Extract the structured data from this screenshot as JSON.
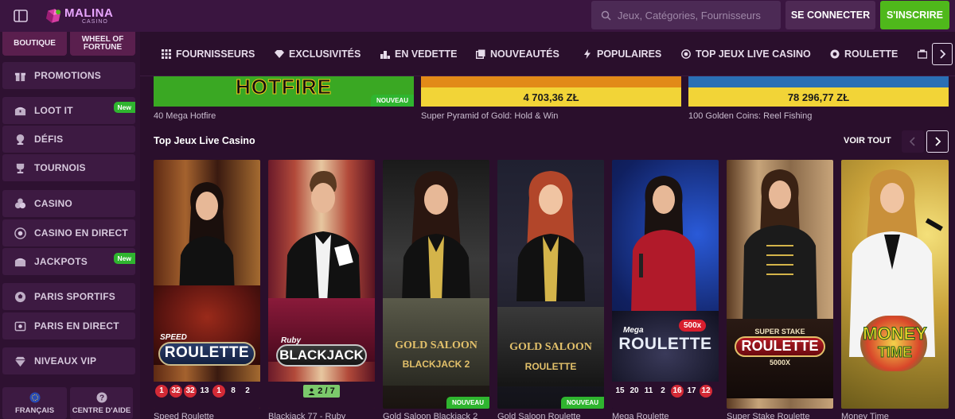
{
  "header": {
    "brand_name": "MALINA",
    "brand_sub": "CASINO",
    "search_placeholder": "Jeux, Catégories, Fournisseurs",
    "login_label": "SE CONNECTER",
    "signup_label": "S'INSCRIRE"
  },
  "sidebar": {
    "top_items": [
      {
        "label": "BOUTIQUE"
      },
      {
        "label": "WHEEL OF FORTUNE"
      }
    ],
    "items": [
      {
        "label": "PROMOTIONS",
        "icon": "gift-icon"
      },
      {
        "label": "LOOT IT",
        "icon": "chest-icon",
        "badge": "New"
      },
      {
        "label": "DÉFIS",
        "icon": "trophy-icon"
      },
      {
        "label": "TOURNOIS",
        "icon": "cup-icon"
      },
      {
        "label": "CASINO",
        "icon": "dice-icon"
      },
      {
        "label": "CASINO EN DIRECT",
        "icon": "roulette-icon"
      },
      {
        "label": "JACKPOTS",
        "icon": "chest-icon",
        "badge": "New"
      },
      {
        "label": "PARIS SPORTIFS",
        "icon": "football-icon"
      },
      {
        "label": "PARIS EN DIRECT",
        "icon": "live-icon"
      },
      {
        "label": "NIVEAUX VIP",
        "icon": "diamond-icon"
      }
    ],
    "bottom": [
      {
        "label": "FRANÇAIS",
        "icon": "flag-eu-icon"
      },
      {
        "label": "CENTRE D'AIDE",
        "icon": "help-icon"
      }
    ]
  },
  "categories": [
    {
      "label": "FOURNISSEURS",
      "icon": "grid-icon"
    },
    {
      "label": "EXCLUSIVITÉS",
      "icon": "gem-icon"
    },
    {
      "label": "EN VEDETTE",
      "icon": "podium-icon"
    },
    {
      "label": "NOUVEAUTÉS",
      "icon": "new-icon"
    },
    {
      "label": "POPULAIRES",
      "icon": "bolt-icon"
    },
    {
      "label": "TOP JEUX LIVE CASINO",
      "icon": "live-icon"
    },
    {
      "label": "ROULETTE",
      "icon": "roulette-icon"
    }
  ],
  "top_cards": [
    {
      "title": "40 Mega Hotfire",
      "banner": "HOTFIRE",
      "badge": "NOUVEAU"
    },
    {
      "title": "Super Pyramid of Gold: Hold & Win",
      "jackpot": "4 703,36 ZŁ"
    },
    {
      "title": "100 Golden Coins: Reel Fishing",
      "jackpot": "78 296,77 ZŁ"
    }
  ],
  "section": {
    "title": "Top Jeux Live Casino",
    "view_all": "VOIR TOUT"
  },
  "games": [
    {
      "title": "Speed Roulette",
      "logo_top": "SPEED",
      "logo_main": "ROULETTE",
      "numbers": [
        "1",
        "32",
        "32",
        "13",
        "1",
        "8",
        "2"
      ],
      "red": [
        true,
        true,
        true,
        false,
        true,
        false,
        false
      ]
    },
    {
      "title": "Blackjack 77 - Ruby",
      "logo_top": "Ruby",
      "logo_main": "BLACKJACK",
      "seats": "2 / 7"
    },
    {
      "title": "Gold Saloon Blackjack 2",
      "logo_top": "GOLD SALOON",
      "logo_main": "BLACKJACK 2",
      "badge": "NOUVEAU"
    },
    {
      "title": "Gold Saloon Roulette",
      "logo_top": "GOLD SALOON",
      "logo_main": "ROULETTE",
      "badge": "NOUVEAU"
    },
    {
      "title": "Mega Roulette",
      "logo_top": "Mega",
      "logo_main": "ROULETTE",
      "multiplier": "500x",
      "numbers": [
        "15",
        "20",
        "11",
        "2",
        "16",
        "17",
        "12"
      ],
      "red": [
        false,
        false,
        false,
        false,
        true,
        false,
        true
      ]
    },
    {
      "title": "Super Stake Roulette",
      "logo_top": "SUPER STAKE",
      "logo_main": "ROULETTE",
      "logo_sub": "5000X"
    },
    {
      "title": "Money Time",
      "logo_top": "MONEY",
      "logo_main": "TIME"
    }
  ]
}
